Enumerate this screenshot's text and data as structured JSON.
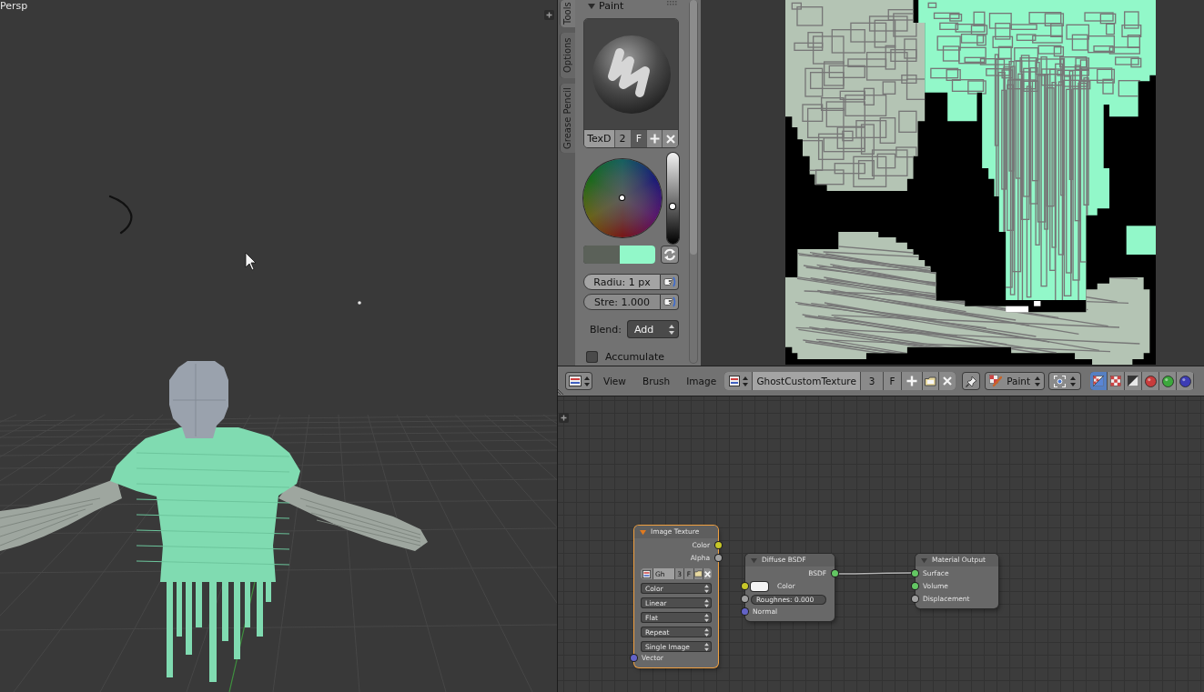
{
  "viewport": {
    "view_label": "Persp"
  },
  "image_editor": {
    "tool_tabs": [
      {
        "label": "Tools",
        "selected": true
      },
      {
        "label": "Options",
        "selected": false
      },
      {
        "label": "Grease Pencil",
        "selected": false
      }
    ],
    "paint_panel": {
      "title": "Paint",
      "expanded": true,
      "brush": {
        "name": "TexD",
        "users": "2",
        "fake_user": {
          "label": "F",
          "on": true
        }
      },
      "value_slider": {
        "level": 0.4
      },
      "color_swatches": [
        {
          "color": "#5b6159"
        },
        {
          "color": "#92f8c9"
        }
      ],
      "fields": [
        {
          "label": "Radiu: 1 px",
          "highlighted": true
        },
        {
          "label": "Stre: 1.000",
          "highlighted": false
        }
      ],
      "blend": {
        "label": "Blend:",
        "value": "Add"
      },
      "accumulate": {
        "label": "Accumulate",
        "checked": false
      }
    },
    "header": {
      "menus": [
        "View",
        "Brush",
        "Image"
      ],
      "image": {
        "name": "GhostCustomTexture",
        "users": "3",
        "fake_user": {
          "label": "F",
          "on": false
        }
      },
      "mode": "Paint",
      "display_channels": [
        {
          "kind": "color_alpha",
          "selected": true
        },
        {
          "kind": "alpha",
          "selected": false
        },
        {
          "kind": "z_buffer",
          "selected": false
        },
        {
          "kind": "sphere",
          "color": "#c83c3c",
          "selected": false
        },
        {
          "kind": "sphere",
          "color": "#3ca83c",
          "selected": false
        },
        {
          "kind": "sphere",
          "color": "#3c3cb4",
          "selected": false
        }
      ]
    }
  },
  "node_editor": {
    "nodes": [
      {
        "title": "Image Texture",
        "selected": true,
        "expanded": true,
        "rows": [
          {
            "kind": "output",
            "label": "Color",
            "socket": {
              "color": "#c7c729"
            }
          },
          {
            "kind": "output",
            "label": "Alpha",
            "socket": {
              "color": "#a1a1a1"
            }
          },
          {
            "kind": "image",
            "name": "Gh",
            "users": "3",
            "fake_user": {
              "label": "F",
              "on": false
            }
          },
          {
            "kind": "dropdown",
            "value": "Color"
          },
          {
            "kind": "dropdown",
            "value": "Linear"
          },
          {
            "kind": "dropdown",
            "value": "Flat"
          },
          {
            "kind": "dropdown",
            "value": "Repeat"
          },
          {
            "kind": "dropdown",
            "value": "Single Image"
          },
          {
            "kind": "input",
            "label": "Vector",
            "socket": {
              "color": "#6363c7"
            }
          }
        ]
      },
      {
        "title": "Diffuse BSDF",
        "selected": false,
        "expanded": true,
        "rows": [
          {
            "kind": "output",
            "label": "BSDF",
            "socket": {
              "color": "#63c763"
            }
          },
          {
            "kind": "color",
            "label": "Color",
            "socket": {
              "color": "#c7c729"
            },
            "color": "#f4f4f4"
          },
          {
            "kind": "number",
            "label": "Roughnes: 0.000",
            "socket": {
              "color": "#a1a1a1"
            }
          },
          {
            "kind": "input",
            "label": "Normal",
            "socket": {
              "color": "#6363c7"
            }
          }
        ]
      },
      {
        "title": "Material Output",
        "selected": false,
        "expanded": true,
        "rows": [
          {
            "kind": "input",
            "label": "Surface",
            "socket": {
              "color": "#63c763"
            }
          },
          {
            "kind": "input",
            "label": "Volume",
            "socket": {
              "color": "#63c763"
            }
          },
          {
            "kind": "input",
            "label": "Displacement",
            "socket": {
              "color": "#a1a1a1"
            }
          }
        ]
      }
    ]
  }
}
